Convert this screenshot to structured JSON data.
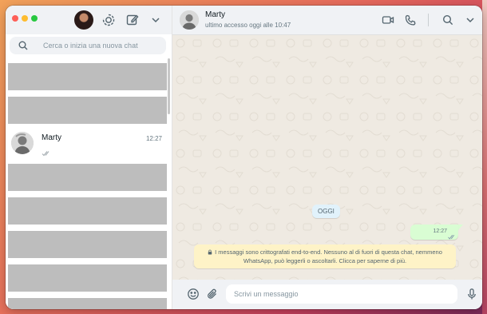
{
  "window": {
    "controls": [
      "close",
      "minimize",
      "maximize"
    ]
  },
  "sidebar": {
    "header_icons": [
      "status-icon",
      "new-chat-icon",
      "chevron-down-icon"
    ],
    "search": {
      "placeholder": "Cerca o inizia una nuova chat",
      "value": ""
    },
    "chats": [
      {
        "redacted": true
      },
      {
        "redacted": true
      },
      {
        "name": "Marty",
        "time": "12:27",
        "read_ticks": "double-check-icon"
      },
      {
        "redacted": true
      },
      {
        "redacted": true
      },
      {
        "redacted": true
      },
      {
        "redacted": true
      },
      {
        "redacted": true
      }
    ]
  },
  "conversation_header": {
    "name": "Marty",
    "status": "ultimo accesso oggi alle 10:47",
    "icons": [
      "video-call-icon",
      "voice-call-icon",
      "search-icon",
      "chevron-down-icon"
    ]
  },
  "conversation": {
    "date_chip": "OGGI",
    "messages": [
      {
        "direction": "out",
        "time": "12:27",
        "status": "double-check-icon"
      }
    ],
    "encryption_notice": {
      "line1": "I messaggi sono crittografati end-to-end. Nessuno al di fuori di questa chat, nemmeno",
      "line2": "WhatsApp, può leggerli o ascoltarli. Clicca per saperne di più.",
      "icon": "lock-icon"
    }
  },
  "composer": {
    "placeholder": "Scrivi un messaggio",
    "value": "",
    "icons": [
      "emoji-icon",
      "attach-icon",
      "microphone-icon"
    ]
  },
  "colors": {
    "panel_header": "#f0f2f5",
    "chat_background": "#efeae2",
    "outgoing_bubble": "#d9fdd3",
    "date_chip": "#e1f2fb",
    "notice": "#fef3c7",
    "redacted_row": "#bdbdbd"
  }
}
